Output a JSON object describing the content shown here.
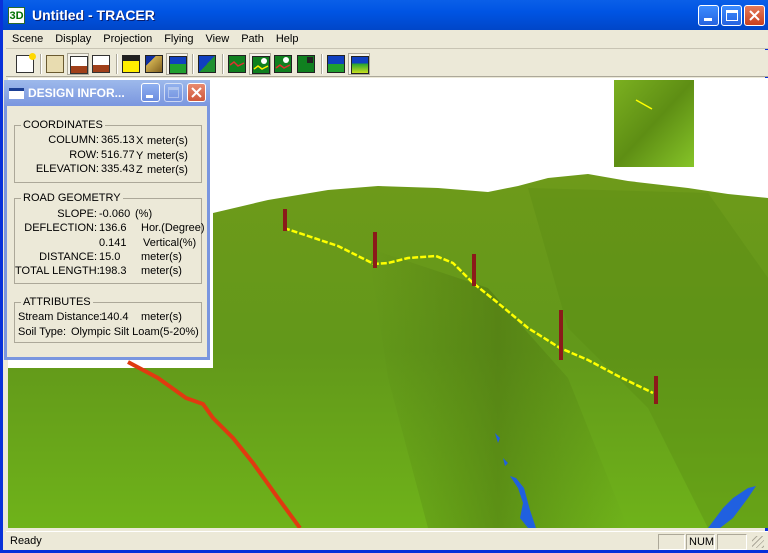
{
  "window": {
    "app_icon": "3D",
    "title": "Untitled - TRACER",
    "minimize_icon": "minimize-icon",
    "maximize_icon": "maximize-icon",
    "close_icon": "close-icon"
  },
  "menu": [
    "Scene",
    "Display",
    "Projection",
    "Flying",
    "View",
    "Path",
    "Help"
  ],
  "toolbar": [
    {
      "name": "new-scene-icon"
    },
    {
      "name": "camera-view-icon"
    },
    {
      "name": "camera-terrain-icon"
    },
    {
      "name": "camera-terrain-alt-icon"
    },
    {
      "name": "buildings-icon"
    },
    {
      "name": "terrain-shaded-icon"
    },
    {
      "name": "mountains-icon"
    },
    {
      "name": "map-overlay-icon"
    },
    {
      "name": "path-line-icon"
    },
    {
      "name": "path-sun-icon"
    },
    {
      "name": "path-sun-alt-icon"
    },
    {
      "name": "path-save-icon"
    },
    {
      "name": "profile-icon"
    },
    {
      "name": "flyover-icon"
    }
  ],
  "dialog": {
    "title": "DESIGN INFOR...",
    "coordinates": {
      "label": "COORDINATES",
      "column_label": "COLUMN:",
      "column_value": "365.13",
      "column_axis": "X",
      "column_unit": "meter(s)",
      "row_label": "ROW:",
      "row_value": "516.77",
      "row_axis": "Y",
      "row_unit": "meter(s)",
      "elevation_label": "ELEVATION:",
      "elevation_value": "335.43",
      "elevation_axis": "Z",
      "elevation_unit": "meter(s)"
    },
    "road_geometry": {
      "label": "ROAD GEOMETRY",
      "slope_label": "SLOPE:",
      "slope_value": "-0.060",
      "slope_unit": "(%)",
      "deflection_label": "DEFLECTION:",
      "deflection_hor_value": "136.6",
      "deflection_hor_unit": "Hor.(Degree)",
      "deflection_vert_value": "0.141",
      "deflection_vert_unit": "Vertical(%)",
      "distance_label": "DISTANCE:",
      "distance_value": "15.0",
      "distance_unit": "meter(s)",
      "total_length_label": "TOTAL LENGTH:",
      "total_length_value": "198.3",
      "total_length_unit": "meter(s)"
    },
    "attributes": {
      "label": "ATTRIBUTES",
      "stream_distance_label": "Stream Distance:",
      "stream_distance_value": "140.4",
      "stream_distance_unit": "meter(s)",
      "soil_type_label": "Soil Type:",
      "soil_type_value": "Olympic Silt Loam(5-20%)"
    }
  },
  "status": {
    "text": "Ready",
    "panel_num": "NUM"
  },
  "colors": {
    "road": "#ffff00",
    "stakes": "#8b1a1a",
    "stream": "#e03010",
    "water": "#2060e0",
    "terrain": "#6aa614"
  }
}
